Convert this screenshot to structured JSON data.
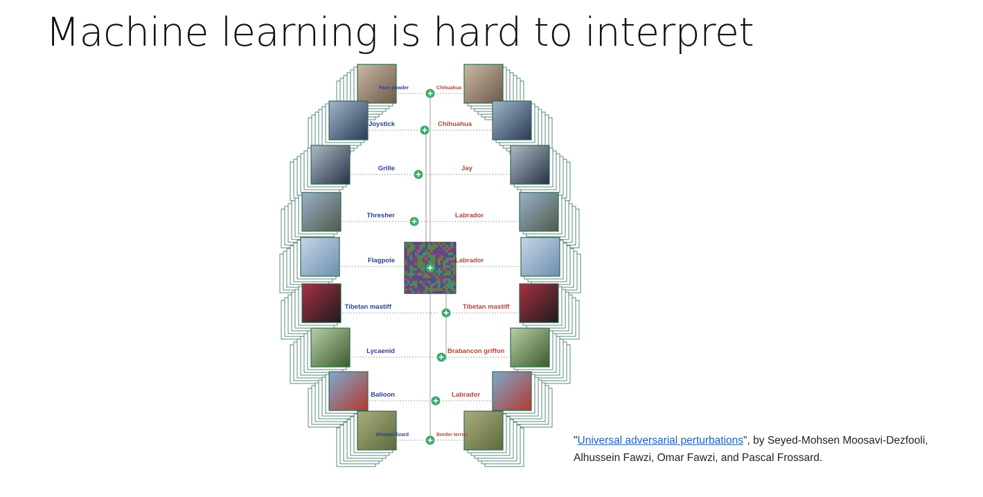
{
  "slide": {
    "title": "Machine learning is hard to interpret"
  },
  "citation": {
    "open_quote": "\"",
    "link_text": "Universal adversarial perturbations",
    "rest": "\", by Seyed-Mohsen Moosavi-Dezfooli, Alhussein Fawzi, Omar Fawzi, and Pascal Frossard."
  },
  "figure": {
    "rows": [
      {
        "original": "Face powder",
        "perturbed": "Chihuahua",
        "img": "face-powder-image",
        "c1": "#6d5a4a",
        "c2": "#c9b9a4"
      },
      {
        "original": "Joystick",
        "perturbed": "Chihuahua",
        "img": "joystick-image",
        "c1": "#2a3a52",
        "c2": "#9fb6cc"
      },
      {
        "original": "Grille",
        "perturbed": "Jay",
        "img": "grille-image",
        "c1": "#273142",
        "c2": "#aebac7"
      },
      {
        "original": "Thresher",
        "perturbed": "Labrador",
        "img": "thresher-image",
        "c1": "#4e5a4a",
        "c2": "#9bb1c9"
      },
      {
        "original": "Flagpole",
        "perturbed": "Labrador",
        "img": "flagpole-image",
        "c1": "#6c8fae",
        "c2": "#c7d6e6"
      },
      {
        "original": "Tibetan mastiff",
        "perturbed": "Tibetan mastiff",
        "img": "mastiff-image",
        "c1": "#1c1c20",
        "c2": "#a83040"
      },
      {
        "original": "Lycaenid",
        "perturbed": "Brabancon griffon",
        "img": "lycaenid-image",
        "c1": "#3d5a2c",
        "c2": "#b8cfa6"
      },
      {
        "original": "Balloon",
        "perturbed": "Labrador",
        "img": "balloon-image",
        "c1": "#b23a2c",
        "c2": "#7fa7cf"
      },
      {
        "original": "Whiptail lizard",
        "perturbed": "Border terrier",
        "img": "lizard-image",
        "c1": "#5e6a3e",
        "c2": "#a9ad7c"
      }
    ],
    "colors": {
      "frame": "#2d6a56",
      "plus": "#3aaa6a",
      "original_label": "#2e3f8f",
      "perturbed_label": "#b0443a"
    }
  }
}
